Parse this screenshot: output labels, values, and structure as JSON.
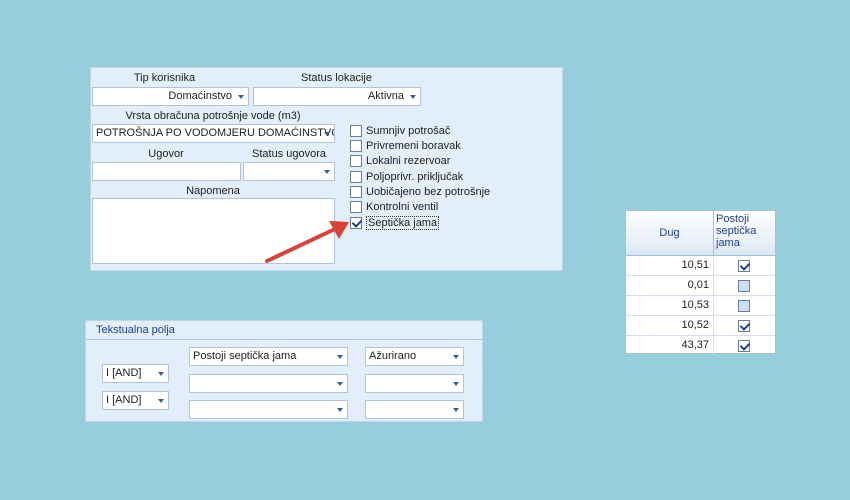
{
  "top_form": {
    "tip_korisnika_label": "Tip korisnika",
    "tip_korisnika_value": "Domaćinstvo",
    "status_lokacije_label": "Status lokacije",
    "status_lokacije_value": "Aktivna",
    "vrsta_label": "Vrsta obračuna potrošnje vode (m3)",
    "vrsta_value": "POTROŠNJA PO VODOMJERU DOMAĆINSTVO",
    "ugovor_label": "Ugovor",
    "status_ugovora_label": "Status ugovora",
    "napomena_label": "Napomena",
    "checkboxes": [
      {
        "label": "Sumnjiv potrošač",
        "checked": false
      },
      {
        "label": "Privremeni boravak",
        "checked": false
      },
      {
        "label": "Lokalni rezervoar",
        "checked": false
      },
      {
        "label": "Poljoprivr. priključak",
        "checked": false
      },
      {
        "label": "Uobičajeno bez potrošnje",
        "checked": false
      },
      {
        "label": "Kontrolni ventil",
        "checked": false
      },
      {
        "label": "Septička jama",
        "checked": true
      }
    ]
  },
  "grid": {
    "col_dug": "Dug",
    "col_septicka": "Postoji septička jama",
    "rows": [
      {
        "dug": "10,51",
        "septicka": true
      },
      {
        "dug": "0,01",
        "septicka": false
      },
      {
        "dug": "10,53",
        "septicka": false
      },
      {
        "dug": "10,52",
        "septicka": true
      },
      {
        "dug": "43,37",
        "septicka": true
      }
    ]
  },
  "text_fields": {
    "title": "Tekstualna polja",
    "rows": [
      {
        "operator": "",
        "field": "Postoji septička jama",
        "value": "Ažurirano"
      },
      {
        "operator": "I [AND]",
        "field": "",
        "value": ""
      },
      {
        "operator": "I [AND]",
        "field": "",
        "value": ""
      }
    ]
  },
  "colors": {
    "background": "#96cedc",
    "panel": "#e3eefb",
    "arrow": "#d9423a",
    "header_text": "#1f3f8a"
  }
}
